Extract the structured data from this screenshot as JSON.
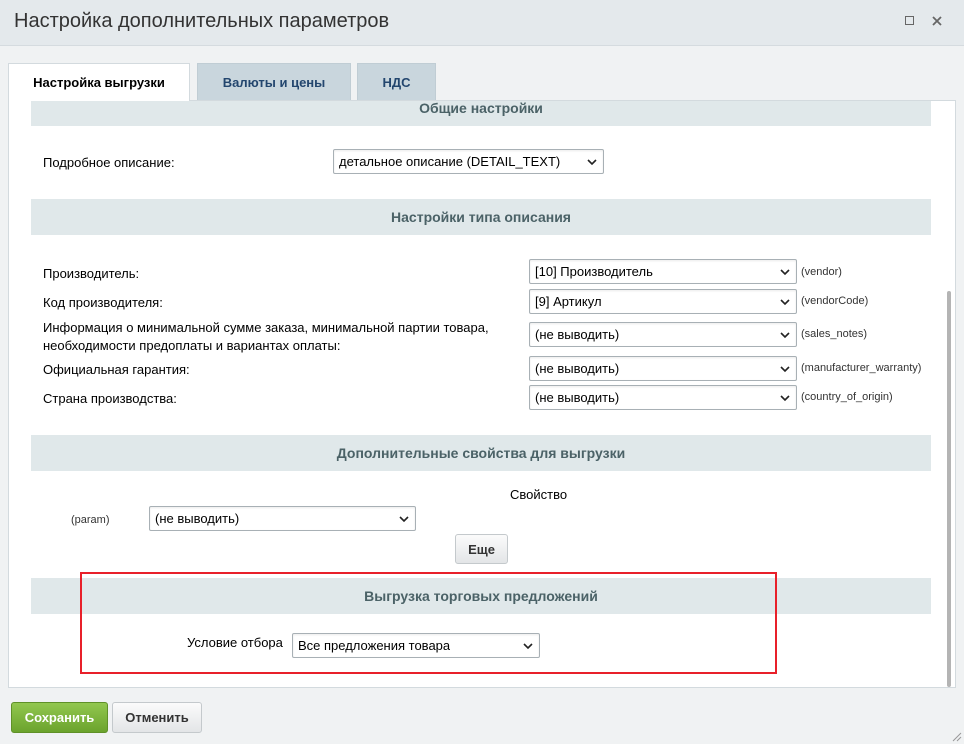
{
  "window": {
    "title": "Настройка дополнительных параметров"
  },
  "tabs": [
    {
      "label": "Настройка выгрузки",
      "active": true
    },
    {
      "label": "Валюты и цены",
      "active": false
    },
    {
      "label": "НДС",
      "active": false
    }
  ],
  "general": {
    "header": "Общие настройки",
    "detail_label": "Подробное описание:",
    "detail_value": "детальное описание (DETAIL_TEXT)"
  },
  "description_type": {
    "header": "Настройки типа описания",
    "rows": [
      {
        "label": "Производитель:",
        "value": "[10] Производитель",
        "code": "(vendor)"
      },
      {
        "label": "Код производителя:",
        "value": "[9] Артикул",
        "code": "(vendorCode)"
      },
      {
        "label_line1": "Информация о минимальной сумме заказа, минимальной партии товара,",
        "label_line2": "необходимости предоплаты и вариантах оплаты:",
        "value": "(не выводить)",
        "code": "(sales_notes)"
      },
      {
        "label": "Официальная гарантия:",
        "value": "(не выводить)",
        "code": "(manufacturer_warranty)"
      },
      {
        "label": "Страна производства:",
        "value": "(не выводить)",
        "code": "(country_of_origin)"
      }
    ]
  },
  "extra_props": {
    "header": "Дополнительные свойства для выгрузки",
    "column_label": "Свойство",
    "param_label": "(param)",
    "param_value": "(не выводить)",
    "more_button": "Еще"
  },
  "offers": {
    "header": "Выгрузка торговых предложений",
    "condition_label": "Условие отбора",
    "condition_value": "Все предложения товара"
  },
  "footer": {
    "save": "Сохранить",
    "cancel": "Отменить"
  },
  "colors": {
    "accent_green": "#7ab33a",
    "highlight_red": "#e8202a",
    "tab_text": "#23466e",
    "section_bg": "#e0e8ea"
  }
}
